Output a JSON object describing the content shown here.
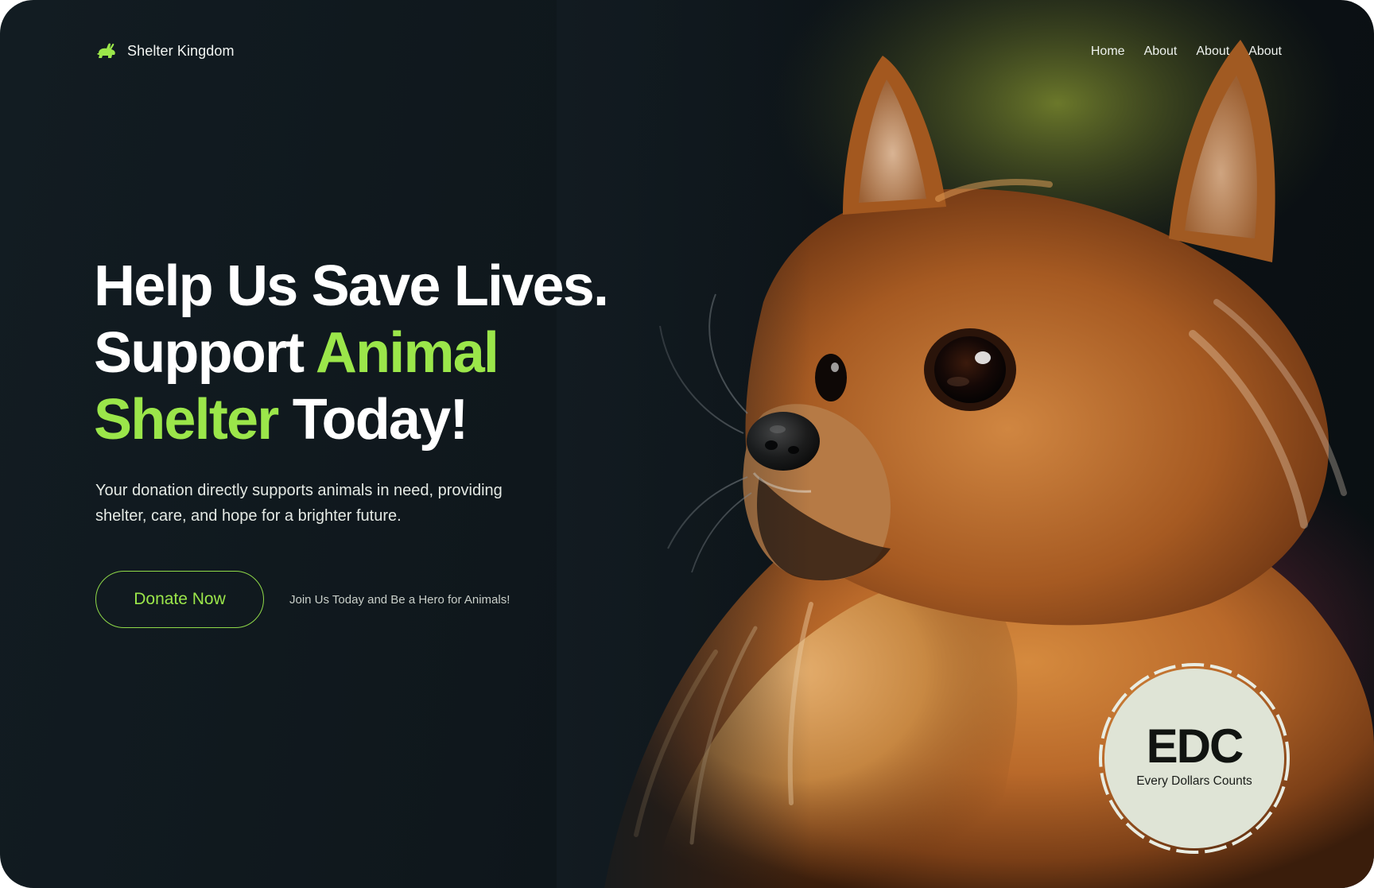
{
  "brand": {
    "name": "Shelter Kingdom",
    "icon": "rabbit-icon"
  },
  "nav": {
    "items": [
      "Home",
      "About",
      "About",
      "About"
    ]
  },
  "hero": {
    "headline": {
      "line1": "Help Us Save Lives.",
      "line2_plain": "Support",
      "line2_accent": "Animal",
      "line3_accent": "Shelter",
      "line3_plain": "Today!"
    },
    "subtitle": "Your donation directly supports animals in need, providing shelter, care, and hope for a brighter future.",
    "donate_label": "Donate Now",
    "cta_note": "Join Us Today and Be a Hero for Animals!"
  },
  "badge": {
    "title": "EDC",
    "caption": "Every Dollars Counts"
  },
  "colors": {
    "background": "#0f171c",
    "accent": "#9be64a",
    "text": "#ffffff",
    "badge_fill": "#dfe4d6"
  }
}
